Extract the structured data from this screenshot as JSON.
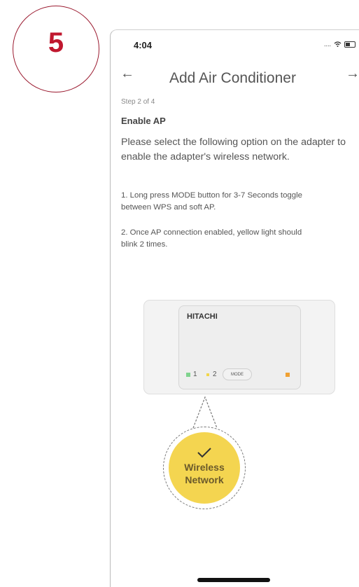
{
  "badge": {
    "number": "5"
  },
  "status_bar": {
    "time": "4:04",
    "signal": "....",
    "wifi_icon": "wifi-icon",
    "battery_icon": "battery-icon"
  },
  "nav": {
    "back_icon": "←",
    "title": "Add Air Conditioner",
    "forward_icon": "→"
  },
  "step_indicator": "Step 2 of 4",
  "section_heading": "Enable AP",
  "instructions": "Please select the following option on the adapter to enable the adapter's wireless network.",
  "steps": [
    {
      "line1": "1. Long press MODE button for 3-7 Seconds toggle",
      "line2": "between WPS and soft AP."
    },
    {
      "line1": "2. Once AP connection enabled, yellow light should",
      "line2": "blink 2 times."
    }
  ],
  "adapter": {
    "brand": "HITACHI",
    "led1_label": "1",
    "led2_label": "2",
    "mode_button": "MODE",
    "colors": {
      "led1": "#7fd38e",
      "led2": "#f2d64a",
      "status_led": "#f0a133"
    }
  },
  "callout": {
    "line1": "Wireless",
    "line2": "Network",
    "icon": "check-icon",
    "color": "#f4d550"
  },
  "colors": {
    "badge_border": "#9b1b30",
    "badge_text": "#c0182f"
  }
}
